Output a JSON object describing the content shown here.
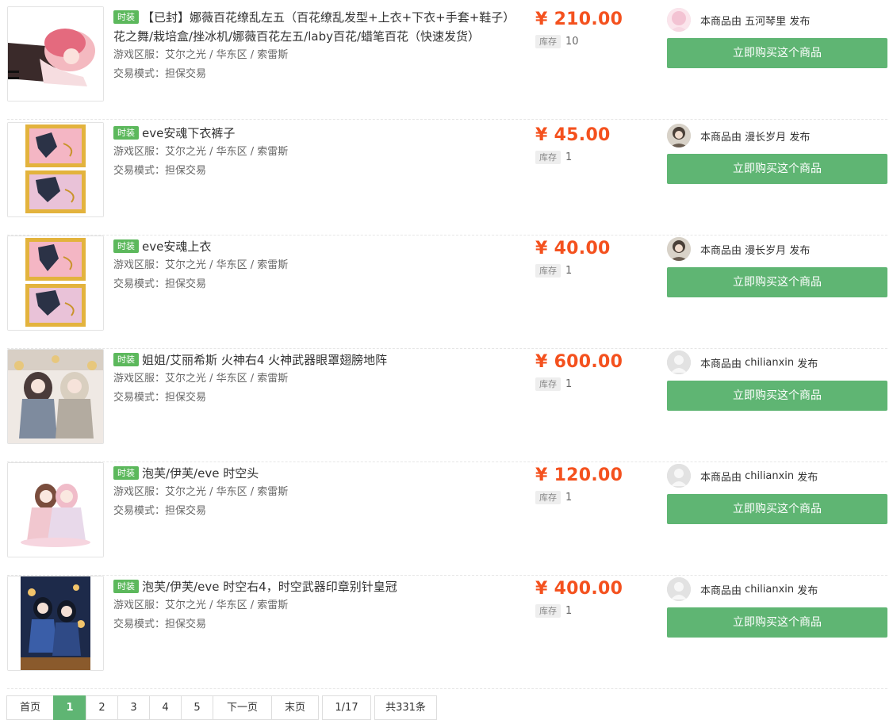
{
  "items": [
    {
      "tag": "时装",
      "title": "【已封】娜薇百花缭乱左五（百花缭乱发型+上衣+下衣+手套+鞋子）花之舞/栽培盒/挫冰机/娜薇百花左五/laby百花/蜡笔百花（快速发货）",
      "server_label": "游戏区服：",
      "server": "艾尔之光 / 华东区 / 索雷斯",
      "mode_label": "交易模式：",
      "mode": "担保交易",
      "price": "¥ 210.00",
      "stock_label": "库存",
      "stock": "10",
      "seller_prefix": "本商品由",
      "seller": "五河琴里",
      "seller_suffix": "发布",
      "buy_label": "立即购买这个商品"
    },
    {
      "tag": "时装",
      "title": "eve安魂下衣裤子",
      "server_label": "游戏区服：",
      "server": "艾尔之光 / 华东区 / 索雷斯",
      "mode_label": "交易模式：",
      "mode": "担保交易",
      "price": "¥ 45.00",
      "stock_label": "库存",
      "stock": "1",
      "seller_prefix": "本商品由",
      "seller": "漫长岁月",
      "seller_suffix": "发布",
      "buy_label": "立即购买这个商品"
    },
    {
      "tag": "时装",
      "title": "eve安魂上衣",
      "server_label": "游戏区服：",
      "server": "艾尔之光 / 华东区 / 索雷斯",
      "mode_label": "交易模式：",
      "mode": "担保交易",
      "price": "¥ 40.00",
      "stock_label": "库存",
      "stock": "1",
      "seller_prefix": "本商品由",
      "seller": "漫长岁月",
      "seller_suffix": "发布",
      "buy_label": "立即购买这个商品"
    },
    {
      "tag": "时装",
      "title": "姐姐/艾丽希斯 火神右4 火神武器眼罩翅膀地阵",
      "server_label": "游戏区服：",
      "server": "艾尔之光 / 华东区 / 索雷斯",
      "mode_label": "交易模式：",
      "mode": "担保交易",
      "price": "¥ 600.00",
      "stock_label": "库存",
      "stock": "1",
      "seller_prefix": "本商品由",
      "seller": "chilianxin",
      "seller_suffix": "发布",
      "buy_label": "立即购买这个商品"
    },
    {
      "tag": "时装",
      "title": "泡芙/伊芙/eve 时空头",
      "server_label": "游戏区服：",
      "server": "艾尔之光 / 华东区 / 索雷斯",
      "mode_label": "交易模式：",
      "mode": "担保交易",
      "price": "¥ 120.00",
      "stock_label": "库存",
      "stock": "1",
      "seller_prefix": "本商品由",
      "seller": "chilianxin",
      "seller_suffix": "发布",
      "buy_label": "立即购买这个商品"
    },
    {
      "tag": "时装",
      "title": "泡芙/伊芙/eve 时空右4，时空武器印章别针皇冠",
      "server_label": "游戏区服：",
      "server": "艾尔之光 / 华东区 / 索雷斯",
      "mode_label": "交易模式：",
      "mode": "担保交易",
      "price": "¥ 400.00",
      "stock_label": "库存",
      "stock": "1",
      "seller_prefix": "本商品由",
      "seller": "chilianxin",
      "seller_suffix": "发布",
      "buy_label": "立即购买这个商品"
    }
  ],
  "pagination": {
    "first": "首页",
    "pages": [
      "1",
      "2",
      "3",
      "4",
      "5"
    ],
    "current": "1",
    "next": "下一页",
    "last": "末页",
    "position": "1/17",
    "total": "共331条"
  },
  "colors": {
    "tag_green": "#5cb85c",
    "button_green": "#5fb573",
    "price_orange": "#f4511e"
  }
}
